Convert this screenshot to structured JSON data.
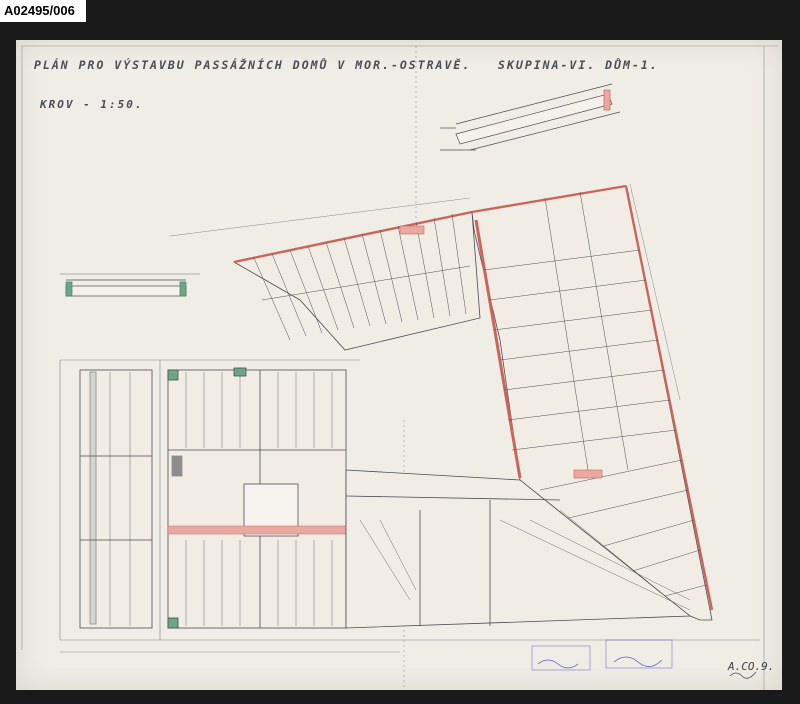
{
  "archive_id": "A02495/006",
  "title": "PLÁN PRO VÝSTAVBU PASSÁŽNÍCH DOMŮ V MOR.-OSTRAVĚ.",
  "group": "SKUPINA-VI. DŮM-1.",
  "subtitle": "KROV - 1:50.",
  "sheet_code": "A.CO.9.",
  "colors": {
    "paper": "#efede6",
    "ink": "#4b4d58",
    "wall_fill": "#e9a8a0",
    "wall_line": "#c9665c",
    "green_detail": "#6ea684",
    "stamp": "#5a5ec0"
  },
  "icons": [
    "roof-plan-drawing",
    "section-detail",
    "stamp",
    "signature"
  ]
}
